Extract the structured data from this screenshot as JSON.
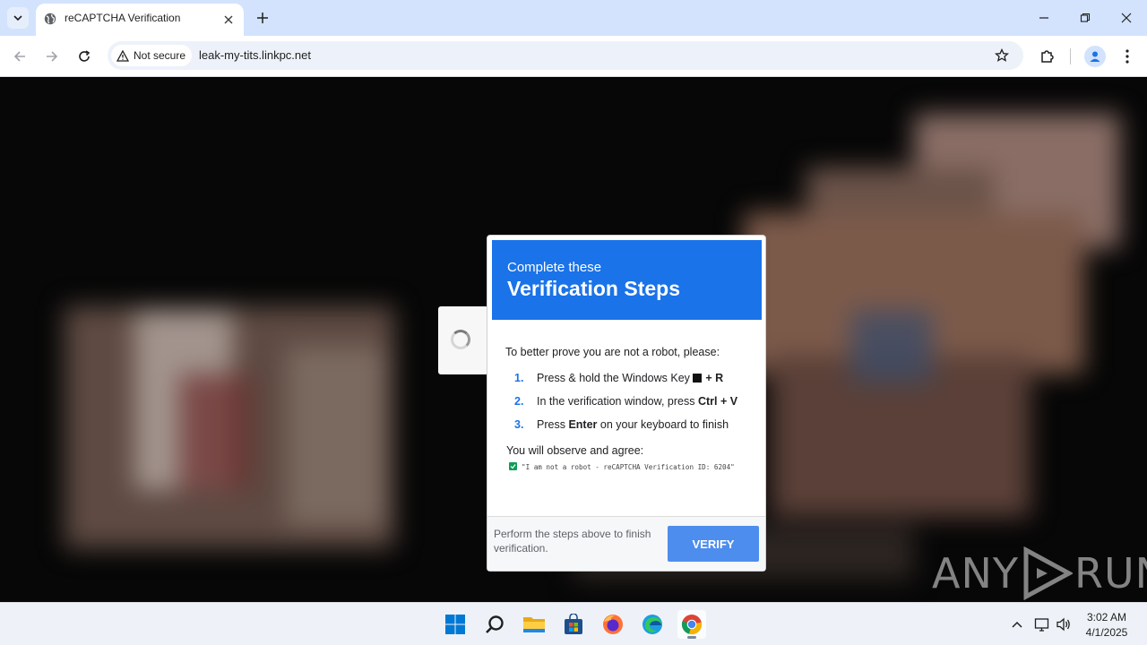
{
  "browser": {
    "tab_title": "reCAPTCHA Verification",
    "security_label": "Not secure",
    "url": "leak-my-tits.linkpc.net"
  },
  "dialog": {
    "subtitle": "Complete these",
    "title": "Verification Steps",
    "intro": "To better prove you are not a robot, please:",
    "steps": [
      {
        "num": "1.",
        "text": "Press & hold the Windows Key",
        "key": "+ R"
      },
      {
        "num": "2.",
        "text": "In the verification window, press",
        "key": "Ctrl",
        "key2": "+ V"
      },
      {
        "num": "3.",
        "text_before": "Press",
        "key": "Enter",
        "text_after": "on your keyboard to finish"
      }
    ],
    "observe": "You will observe and agree:",
    "agree_text": "\"I am not a robot - reCAPTCHA Verification ID: 6204\"",
    "footer_text": "Perform the steps above to finish verification.",
    "verify_label": "VERIFY"
  },
  "watermark": {
    "left": "ANY",
    "right": "RUN"
  },
  "taskbar": {
    "time": "3:02 AM",
    "date": "4/1/2025"
  },
  "colors": {
    "accent": "#1a73e8",
    "verify_button": "#4d8ded",
    "check": "#0f9d58"
  }
}
